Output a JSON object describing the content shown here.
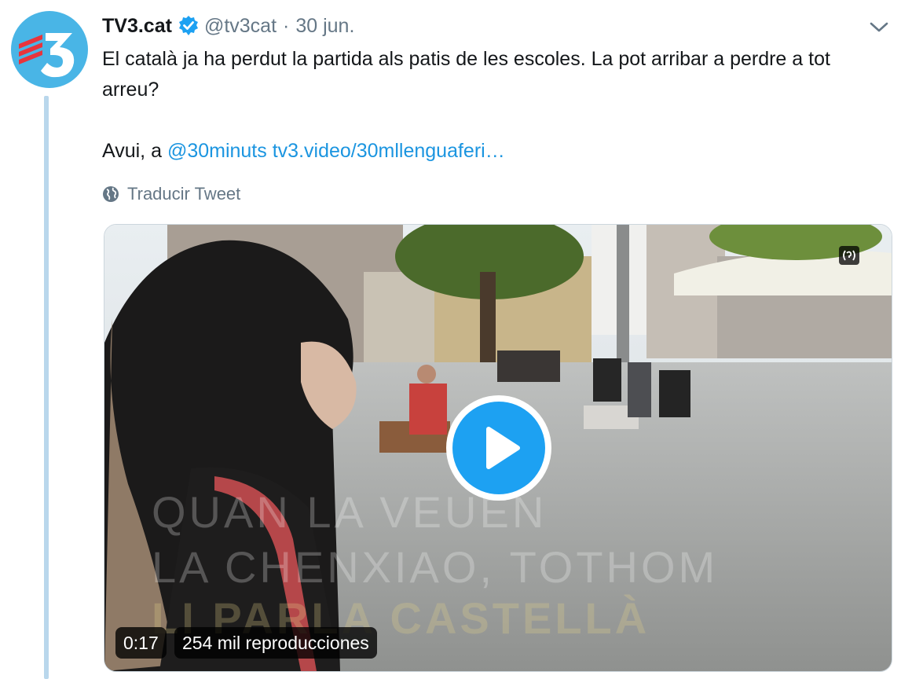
{
  "tweet": {
    "author_name": "TV3.cat",
    "handle": "@tv3cat",
    "separator": "·",
    "date": "30 jun.",
    "text_line1": "El català ja ha perdut la partida als patis de les escoles. La pot arribar a perdre a tot arreu?",
    "text_prefix": "Avui, a ",
    "mention": "@30minuts",
    "link": "tv3.video/30mllenguaferi…",
    "translate_label": "Traducir Tweet"
  },
  "media": {
    "duration": "0:17",
    "views": "254 mil reproducciones",
    "overlay_text_1": "QUAN LA VEUEN",
    "overlay_text_2": "LA CHENXIAO, TOTHOM",
    "overlay_text_3": "LI PARLA CASTELLÀ"
  },
  "icons": {
    "verified": "verified-badge-icon",
    "chevron": "chevron-down-icon",
    "globe": "globe-icon",
    "play": "play-icon",
    "sound": "sound-icon"
  },
  "colors": {
    "accent": "#1da1f2",
    "link": "#1b95e0",
    "secondary_text": "#657786",
    "avatar_bg": "#49b5e6",
    "logo_red": "#e8343c"
  }
}
